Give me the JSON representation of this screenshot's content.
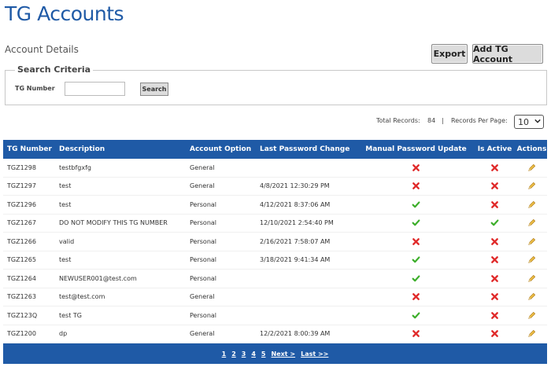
{
  "page": {
    "title": "TG Accounts",
    "section": "Account Details"
  },
  "toolbar": {
    "export_label": "Export",
    "add_label": "Add TG Account"
  },
  "search": {
    "legend": "Search Criteria",
    "tg_label": "TG Number",
    "tg_value": "",
    "button_label": "Search"
  },
  "records": {
    "total_label": "Total Records:",
    "total_value": "84",
    "separator": "|",
    "per_page_label": "Records Per Page:",
    "per_page_value": "10"
  },
  "table": {
    "columns": [
      "TG Number",
      "Description",
      "Account Option",
      "Last Password Change",
      "Manual Password Update",
      "Is Active",
      "Actions"
    ],
    "rows": [
      {
        "tg": "TGZ1298",
        "desc": "testbfgxfg",
        "opt": "General",
        "pwd": "",
        "manual": "x",
        "active": "x"
      },
      {
        "tg": "TGZ1297",
        "desc": "test",
        "opt": "General",
        "pwd": "4/8/2021 12:30:29 PM",
        "manual": "x",
        "active": "x"
      },
      {
        "tg": "TGZ1296",
        "desc": "test",
        "opt": "Personal",
        "pwd": "4/12/2021 8:37:06 AM",
        "manual": "check",
        "active": "x"
      },
      {
        "tg": "TGZ1267",
        "desc": "DO NOT MODIFY THIS TG NUMBER",
        "opt": "Personal",
        "pwd": "12/10/2021 2:54:40 PM",
        "manual": "check",
        "active": "check"
      },
      {
        "tg": "TGZ1266",
        "desc": "valid",
        "opt": "Personal",
        "pwd": "2/16/2021 7:58:07 AM",
        "manual": "x",
        "active": "x"
      },
      {
        "tg": "TGZ1265",
        "desc": "test",
        "opt": "Personal",
        "pwd": "3/18/2021 9:41:34 AM",
        "manual": "check",
        "active": "x"
      },
      {
        "tg": "TGZ1264",
        "desc": "NEWUSER001@test.com",
        "opt": "Personal",
        "pwd": "",
        "manual": "check",
        "active": "x"
      },
      {
        "tg": "TGZ1263",
        "desc": "test@test.com",
        "opt": "General",
        "pwd": "",
        "manual": "x",
        "active": "x"
      },
      {
        "tg": "TGZ123Q",
        "desc": "test TG",
        "opt": "Personal",
        "pwd": "",
        "manual": "check",
        "active": "x"
      },
      {
        "tg": "TGZ1200",
        "desc": "dp",
        "opt": "General",
        "pwd": "12/2/2021 8:00:39 AM",
        "manual": "x",
        "active": "x"
      }
    ]
  },
  "pager": {
    "pages": [
      "1",
      "2",
      "3",
      "4",
      "5"
    ],
    "next": "Next >",
    "last": "Last >>"
  },
  "colors": {
    "brand": "#1f5aa6",
    "x": "#e02a2a",
    "check": "#3cae2a",
    "pencil": "#d9a21c"
  },
  "icons": {
    "x": "close-icon",
    "check": "checkmark-icon",
    "edit": "pencil-icon",
    "dropdown": "chevron-down-icon"
  }
}
